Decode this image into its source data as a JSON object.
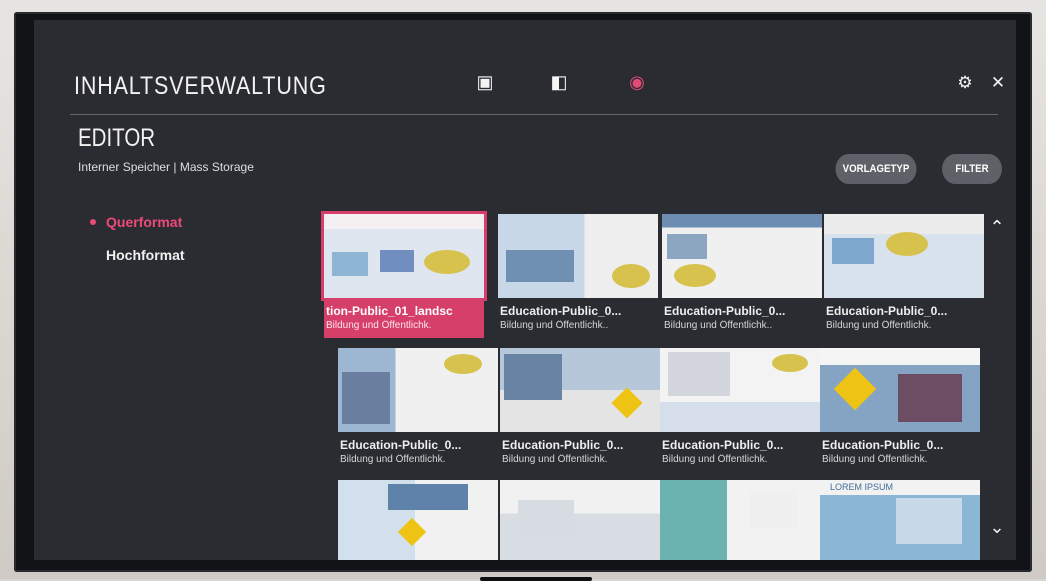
{
  "app": {
    "title": "INHALTSVERWALTUNG",
    "section": "EDITOR",
    "storage": "Interner Speicher | Mass Storage"
  },
  "top_icons": [
    {
      "name": "video-icon",
      "glyph": "▣"
    },
    {
      "name": "schedule-icon",
      "glyph": "◧"
    },
    {
      "name": "apple-icon",
      "glyph": "◉"
    }
  ],
  "actions": {
    "template_type": "VORLAGETYP",
    "filter": "FILTER"
  },
  "menu": [
    {
      "label": "Querformat",
      "active": true
    },
    {
      "label": "Hochformat",
      "active": false
    }
  ],
  "cards": [
    {
      "title": "tion-Public_01_landsc",
      "subtitle": "Bildung und Öffentlichk."
    },
    {
      "title": "Education-Public_0...",
      "subtitle": "Bildung und Öffentlichk.."
    },
    {
      "title": "Education-Public_0...",
      "subtitle": "Bildung und Öffentlichk.."
    },
    {
      "title": "Education-Public_0...",
      "subtitle": "Bildung und Öffentlichk."
    },
    {
      "title": "Education-Public_0...",
      "subtitle": "Bildung und Öffentlichk."
    },
    {
      "title": "Education-Public_0...",
      "subtitle": "Bildung und Öffentlichk."
    },
    {
      "title": "Education-Public_0...",
      "subtitle": "Bildung und Öffentlichk."
    },
    {
      "title": "Education-Public_0...",
      "subtitle": "Bildung und Öffentlichk."
    },
    {
      "title": "",
      "subtitle": ""
    },
    {
      "title": "",
      "subtitle": ""
    },
    {
      "title": "",
      "subtitle": ""
    },
    {
      "title": "LOREM IPSUM",
      "subtitle": ""
    }
  ],
  "icons": {
    "settings": "⚙",
    "close": "✕",
    "up": "⌃",
    "down": "⌄"
  },
  "colors": {
    "accent": "#e14b76",
    "panel": "#2a2c31"
  }
}
